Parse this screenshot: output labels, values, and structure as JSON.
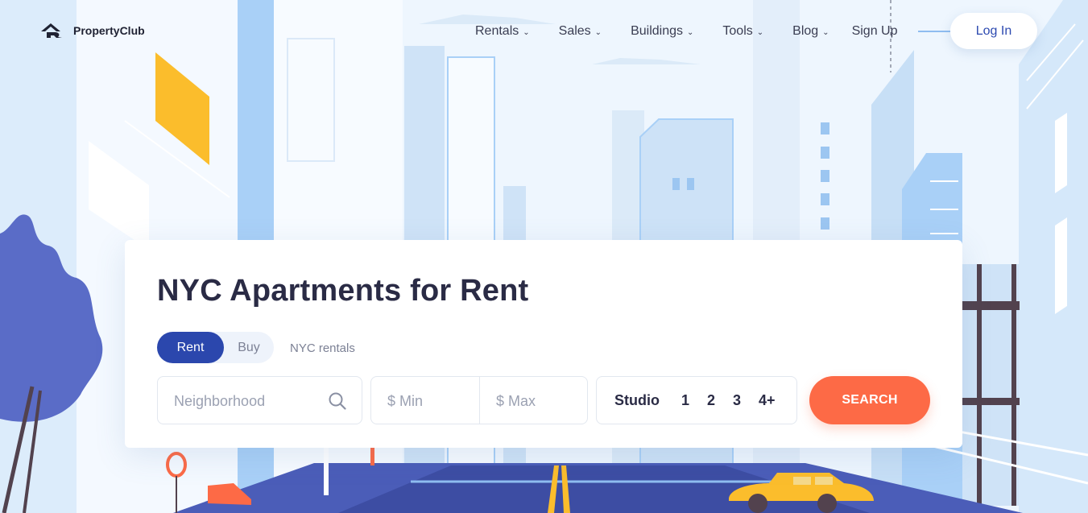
{
  "brand": {
    "name": "PropertyClub"
  },
  "nav": {
    "items": [
      {
        "label": "Rentals"
      },
      {
        "label": "Sales"
      },
      {
        "label": "Buildings"
      },
      {
        "label": "Tools"
      },
      {
        "label": "Blog"
      }
    ],
    "signup_label": "Sign Up",
    "login_label": "Log In"
  },
  "hero": {
    "title": "NYC Apartments for Rent",
    "toggle": {
      "rent_label": "Rent",
      "buy_label": "Buy",
      "selected": "Rent"
    },
    "caption": "NYC rentals",
    "neighborhood_placeholder": "Neighborhood",
    "min_placeholder": "$ Min",
    "max_placeholder": "$ Max",
    "beds": [
      "Studio",
      "1",
      "2",
      "3",
      "4+"
    ],
    "search_label": "SEARCH"
  },
  "colors": {
    "brand_blue": "#2b47ad",
    "search_orange": "#fd6a46",
    "taxi_yellow": "#fbbd2c",
    "road": "#4b5db8",
    "sky": "#e9f3fd"
  },
  "icons": [
    "logo-icon",
    "chevron-down-icon",
    "search-icon"
  ]
}
